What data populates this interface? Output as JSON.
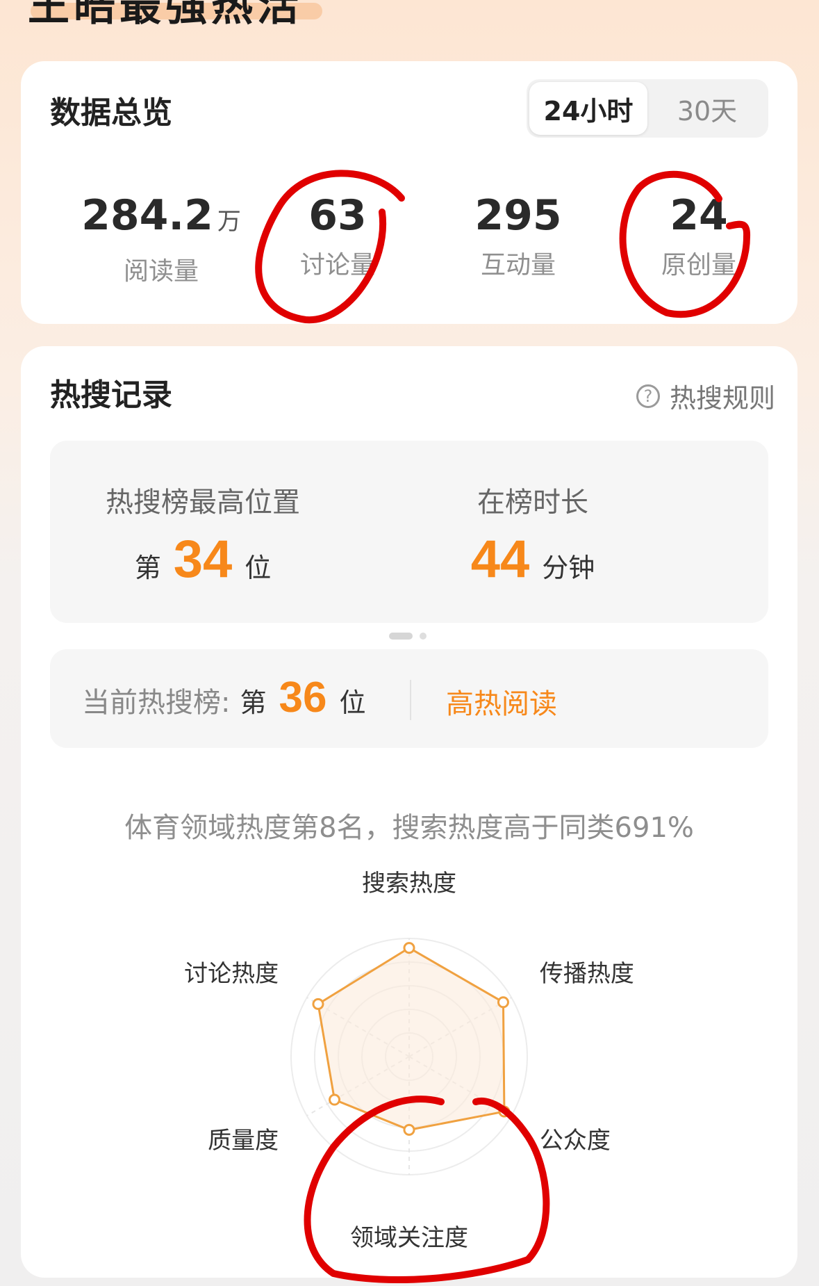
{
  "page": {
    "title": "王皓最强热活"
  },
  "overview": {
    "title": "数据总览",
    "tabs": [
      {
        "label": "24小时",
        "active": true
      },
      {
        "label": "30天",
        "active": false
      }
    ],
    "metrics": [
      {
        "value": "284.2",
        "unit": "万",
        "label": "阅读量"
      },
      {
        "value": "63",
        "unit": "",
        "label": "讨论量"
      },
      {
        "value": "295",
        "unit": "",
        "label": "互动量"
      },
      {
        "value": "24",
        "unit": "",
        "label": "原创量"
      }
    ]
  },
  "hot_search": {
    "title": "热搜记录",
    "rules_label": "热搜规则",
    "rules_icon": "question-circle-icon",
    "highest": {
      "caption": "热搜榜最高位置",
      "prefix": "第",
      "value": "34",
      "suffix": "位"
    },
    "duration": {
      "caption": "在榜时长",
      "value": "44",
      "unit": "分钟"
    },
    "current": {
      "label": "当前热搜榜:",
      "prefix": "第",
      "value": "36",
      "suffix": "位",
      "link": "高热阅读"
    },
    "summary": "体育领域热度第8名，搜索热度高于同类691%"
  },
  "chart_data": {
    "type": "radar",
    "axes": [
      "搜索热度",
      "传播热度",
      "公众度",
      "领域关注度",
      "质量度",
      "讨论热度"
    ],
    "values": [
      0.92,
      0.92,
      0.93,
      0.62,
      0.73,
      0.89
    ],
    "max": 1,
    "rings": 5,
    "colors": {
      "line": "#f0a140",
      "fill": "#fcebdc",
      "grid": "#ececec"
    }
  },
  "colors": {
    "accent": "#f7881a",
    "annotation": "#e00000"
  }
}
